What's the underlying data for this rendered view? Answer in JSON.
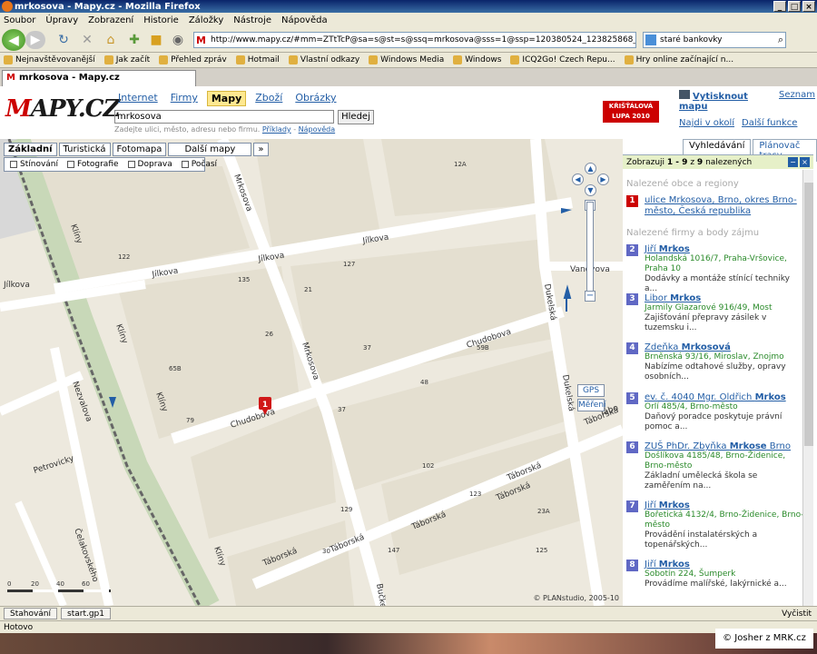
{
  "window": {
    "title": "mrkosova - Mapy.cz - Mozilla Firefox"
  },
  "menu": [
    "Soubor",
    "Úpravy",
    "Zobrazení",
    "Historie",
    "Záložky",
    "Nástroje",
    "Nápověda"
  ],
  "nav": {
    "url": "http://www.mapy.cz/#mm=ZTtTcP@sa=s@st=s@ssq=mrkosova@sss=1@ssp=120380524_123825868_150199404_150073036",
    "search_value": "staré bankovky"
  },
  "bookmarks": [
    "Nejnavštěvovanější",
    "Jak začít",
    "Přehled zpráv",
    "Hotmail",
    "Vlastní odkazy",
    "Windows Media",
    "Windows",
    "ICQ2Go! Czech Repu...",
    "Hry online začínající n..."
  ],
  "tab": {
    "title": "mrkosova - Mapy.cz"
  },
  "site": {
    "logo_m": "M",
    "logo_rest": "APY.CZ",
    "nav": [
      "Internet",
      "Firmy",
      "Mapy",
      "Zboží",
      "Obrázky"
    ],
    "search_value": "mrkosova",
    "search_button": "Hledej",
    "hint_text": "Zadejte ulici, město, adresu nebo firmu.",
    "hint_link1": "Příklady",
    "hint_sep": "-",
    "hint_link2": "Nápověda",
    "badge_line1": "KŘIŠŤÁLOVÁ",
    "badge_line2": "LUPA 2010",
    "print_label": "Vytisknout mapu",
    "seznam_label": "Seznam",
    "nearby_label": "Najdi v okolí",
    "more_label": "Další funkce"
  },
  "map": {
    "types": [
      "Základní",
      "Turistická",
      "Fotomapa",
      "Další mapy"
    ],
    "options": [
      "Stínování",
      "Fotografie",
      "Doprava",
      "Počasí"
    ],
    "gps_label": "GPS",
    "measure_label": "Měření",
    "copyright": "© PLANstudio, 2005-10",
    "scale_labels": [
      "0",
      "20",
      "40",
      "60"
    ],
    "marker_label": "1",
    "streets": [
      "Jílkova",
      "Jílkova",
      "Jílkova",
      "Jílkova",
      "Mrkosova",
      "Mrkosova",
      "Chudobova",
      "Chudobova",
      "Dukelská",
      "Dukelská",
      "Klíny",
      "Klíny",
      "Klíny",
      "Klíny",
      "Táborská",
      "Táborská",
      "Táborská",
      "Táborská",
      "Táborská",
      "Táborská",
      "Vanovova",
      "Nezvalova",
      "Petrovicky",
      "Čelakovského",
      "Bučke",
      "Tábo"
    ],
    "numbers": [
      "12A",
      "127",
      "122",
      "135",
      "21",
      "26",
      "37",
      "59B",
      "65B",
      "79",
      "48",
      "102",
      "37",
      "30",
      "123",
      "129",
      "23A",
      "147",
      "125"
    ]
  },
  "panel": {
    "tabs": [
      "Vyhledávání",
      "Plánovač trasy"
    ],
    "summary_pre": "Zobrazuji",
    "summary_range": "1 - 9",
    "summary_mid": "z",
    "summary_total": "9",
    "summary_post": "nalezených",
    "section_regions": "Nalezené obce a regiony",
    "section_firms": "Nalezené firmy a body zájmu",
    "results": [
      {
        "num": "1",
        "name": "ulice Mrkosova, Brno, okres Brno-město, Česká republika",
        "addr": "",
        "desc": ""
      },
      {
        "num": "2",
        "name_pre": "Jiří ",
        "name_bold": "Mrkos",
        "name_post": "",
        "addr": "Holandská 1016/7, Praha-Vršovice, Praha 10",
        "desc": "Dodávky a montáže stínící techniky a..."
      },
      {
        "num": "3",
        "name_pre": "Libor ",
        "name_bold": "Mrkos",
        "name_post": "",
        "addr": "Jarmily Glazarové 916/49, Most",
        "desc": "Zajišťování přepravy zásilek v tuzemsku i..."
      },
      {
        "num": "4",
        "name_pre": "Zdeňka ",
        "name_bold": "Mrkosová",
        "name_post": "",
        "addr": "Brněnská 93/16, Miroslav, Znojmo",
        "desc": "Nabízíme odtahové služby, opravy osobních..."
      },
      {
        "num": "5",
        "name_pre": "ev. č. 4040 Mgr. Oldřich ",
        "name_bold": "Mrkos",
        "name_post": "",
        "addr": "Orlí 485/4, Brno-město",
        "desc": "Daňový poradce poskytuje právní pomoc a..."
      },
      {
        "num": "6",
        "name_pre": "ZUŠ PhDr. Zbyňka ",
        "name_bold": "Mrkose",
        "name_post": " Brno",
        "addr": "Došlíkova 4185/48, Brno-Židenice, Brno-město",
        "desc": "Základní umělecká škola se zaměřením na..."
      },
      {
        "num": "7",
        "name_pre": "Jiří ",
        "name_bold": "Mrkos",
        "name_post": "",
        "addr": "Bořetická 4132/4, Brno-Židenice, Brno-město",
        "desc": "Provádění instalatérských a topenářských..."
      },
      {
        "num": "8",
        "name_pre": "Jiří ",
        "name_bold": "Mrkos",
        "name_post": "",
        "addr": "Sobotín 224, Šumperk",
        "desc": "Provádíme malířské, lakýrnické a..."
      }
    ]
  },
  "taskbar": {
    "items": [
      "Stahování",
      "start.gp1"
    ],
    "right": "Vyčistit"
  },
  "status": {
    "text": "Hotovo"
  },
  "watermark": "© Josher z MRK.cz"
}
